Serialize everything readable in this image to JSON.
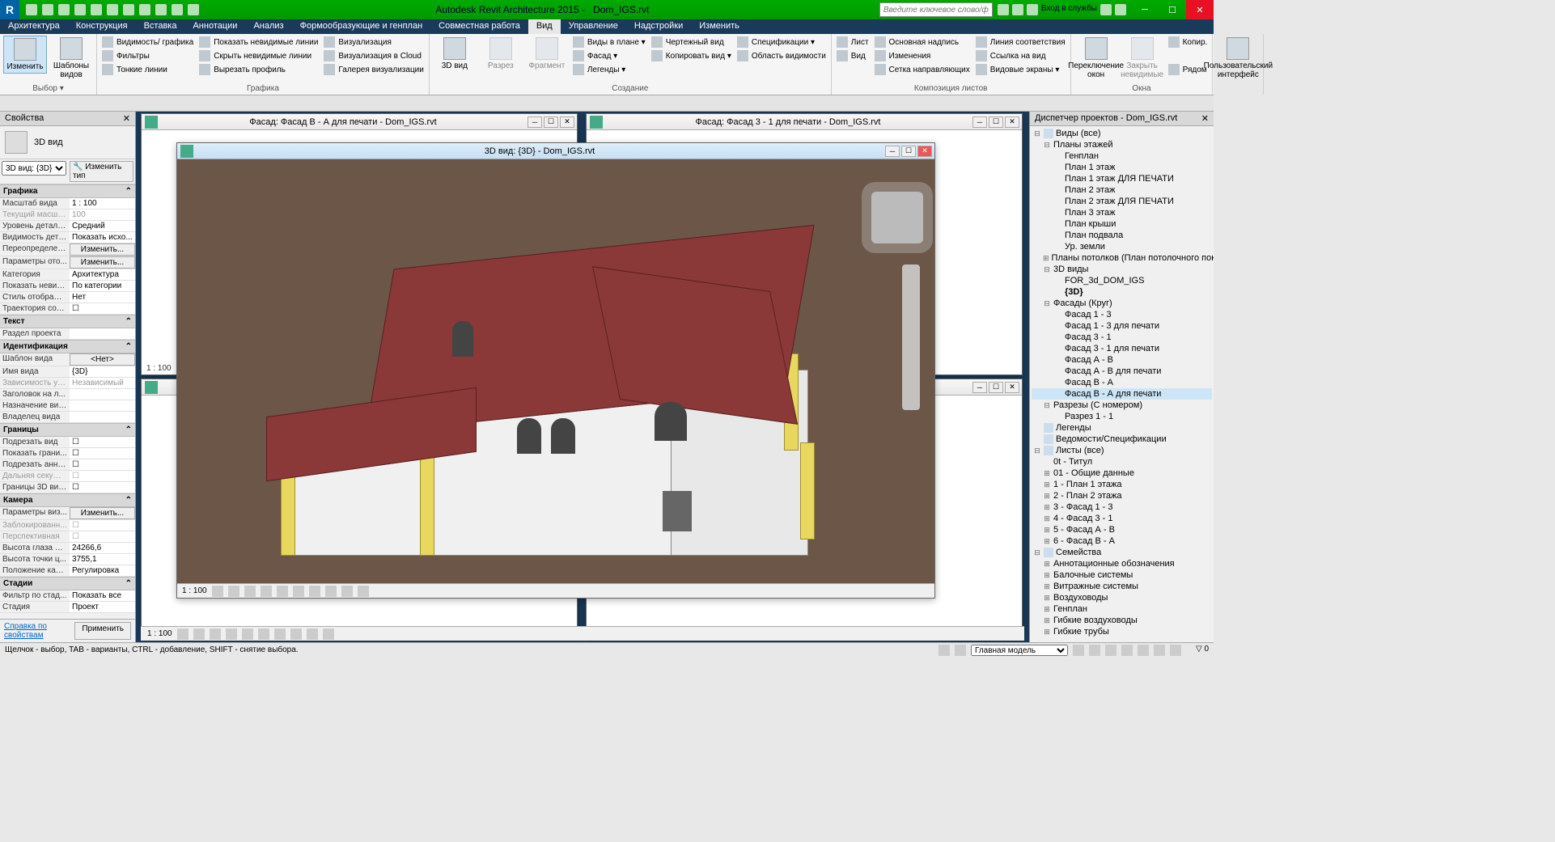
{
  "titlebar": {
    "app": "Autodesk Revit Architecture 2015 -",
    "file": "Dom_IGS.rvt",
    "search_placeholder": "Введите ключевое слово/фразу",
    "login": "Вход в службы"
  },
  "menutabs": [
    "Архитектура",
    "Конструкция",
    "Вставка",
    "Аннотации",
    "Анализ",
    "Формообразующие и генплан",
    "Совместная работа",
    "Вид",
    "Управление",
    "Надстройки",
    "Изменить"
  ],
  "menutab_active": 7,
  "ribbon": {
    "groups": [
      {
        "label": "Выбор ▾",
        "big": [
          {
            "t": "Изменить",
            "sel": true
          },
          {
            "t": "Шаблоны видов"
          }
        ]
      },
      {
        "label": "Графика",
        "cols": [
          [
            "Видимость/ графика",
            "Фильтры",
            "Тонкие линии"
          ],
          [
            "Показать невидимые линии",
            "Скрыть невидимые линии",
            "Вырезать профиль"
          ],
          [
            "Визуализация",
            "Визуализация в Cloud",
            "Галерея визуализации"
          ]
        ]
      },
      {
        "label": "Создание",
        "big": [
          {
            "t": "3D вид"
          },
          {
            "t": "Разрез",
            "dis": true
          },
          {
            "t": "Фрагмент",
            "dis": true
          }
        ],
        "cols": [
          [
            "Виды в плане ▾",
            "Фасад ▾",
            "Легенды ▾"
          ],
          [
            "Чертежный вид",
            "Копировать вид ▾",
            ""
          ],
          [
            "Спецификации ▾",
            "Область видимости",
            ""
          ]
        ]
      },
      {
        "label": "Композиция листов",
        "cols": [
          [
            "Лист",
            "Вид",
            ""
          ],
          [
            "Основная надпись",
            "Изменения",
            "Сетка направляющих"
          ],
          [
            "Линия соответствия",
            "Ссылка на вид",
            "Видовые экраны ▾"
          ]
        ]
      },
      {
        "label": "Окна",
        "big": [
          {
            "t": "Переключение окон"
          },
          {
            "t": "Закрыть невидимые",
            "dis": true
          }
        ],
        "cols": [
          [
            "Копир.",
            "",
            "Рядом"
          ]
        ]
      },
      {
        "label": "",
        "big": [
          {
            "t": "Пользовательский интерфейс"
          }
        ]
      }
    ]
  },
  "properties": {
    "title": "Свойства",
    "viewtype": "3D вид",
    "selector": "3D вид: {3D}",
    "edit_type": "Изменить тип",
    "groups": [
      {
        "name": "Графика",
        "rows": [
          {
            "k": "Масштаб вида",
            "v": "1 : 100"
          },
          {
            "k": "Текущий масшт...",
            "v": "100",
            "dis": true
          },
          {
            "k": "Уровень детали...",
            "v": "Средний"
          },
          {
            "k": "Видимость дета...",
            "v": "Показать исхо..."
          },
          {
            "k": "Переопределен...",
            "v": "Изменить...",
            "btn": true
          },
          {
            "k": "Параметры ото...",
            "v": "Изменить...",
            "btn": true
          },
          {
            "k": "Категория",
            "v": "Архитектура"
          },
          {
            "k": "Показать невид...",
            "v": "По категории"
          },
          {
            "k": "Стиль отображе...",
            "v": "Нет"
          },
          {
            "k": "Траектория сол...",
            "v": "",
            "chk": true
          }
        ]
      },
      {
        "name": "Текст",
        "rows": [
          {
            "k": "Раздел проекта",
            "v": ""
          }
        ]
      },
      {
        "name": "Идентификация",
        "rows": [
          {
            "k": "Шаблон вида",
            "v": "<Нет>",
            "btn": true
          },
          {
            "k": "Имя вида",
            "v": "{3D}"
          },
          {
            "k": "Зависимость ур...",
            "v": "Независимый",
            "dis": true
          },
          {
            "k": "Заголовок на л...",
            "v": ""
          },
          {
            "k": "Назначение вида",
            "v": ""
          },
          {
            "k": "Владелец вида",
            "v": ""
          }
        ]
      },
      {
        "name": "Границы",
        "rows": [
          {
            "k": "Подрезать вид",
            "v": "",
            "chk": true
          },
          {
            "k": "Показать грани...",
            "v": "",
            "chk": true
          },
          {
            "k": "Подрезать анно...",
            "v": "",
            "chk": true
          },
          {
            "k": "Дальняя секуща...",
            "v": "",
            "chk": true,
            "dis": true
          },
          {
            "k": "Границы 3D вида",
            "v": "",
            "chk": true
          }
        ]
      },
      {
        "name": "Камера",
        "rows": [
          {
            "k": "Параметры виз...",
            "v": "Изменить...",
            "btn": true
          },
          {
            "k": "Заблокированн...",
            "v": "",
            "chk": true,
            "dis": true
          },
          {
            "k": "Перспективная",
            "v": "",
            "chk": true,
            "dis": true
          },
          {
            "k": "Высота глаза на...",
            "v": "24266,6"
          },
          {
            "k": "Высота точки ц...",
            "v": "3755,1"
          },
          {
            "k": "Положение кам...",
            "v": "Регулировка"
          }
        ]
      },
      {
        "name": "Стадии",
        "rows": [
          {
            "k": "Фильтр по стад...",
            "v": "Показать все"
          },
          {
            "k": "Стадия",
            "v": "Проект"
          }
        ]
      }
    ],
    "help": "Справка по свойствам",
    "apply": "Применить"
  },
  "windows": {
    "w1": {
      "title": "Фасад: Фасад В - А для печати - Dom_IGS.rvt",
      "scale": "1 : 100"
    },
    "w2": {
      "title": "Фасад: Фасад 3 - 1 для печати - Dom_IGS.rvt"
    },
    "w3": {
      "title": "3D вид: {3D} - Dom_IGS.rvt",
      "scale": "1 : 100"
    }
  },
  "browser": {
    "title": "Диспетчер проектов - Dom_IGS.rvt",
    "nodes": [
      {
        "l": 0,
        "t": "Виды (все)",
        "exp": "-",
        "icon": true
      },
      {
        "l": 1,
        "t": "Планы этажей",
        "exp": "-"
      },
      {
        "l": 2,
        "t": "Генплан"
      },
      {
        "l": 2,
        "t": "План 1 этаж"
      },
      {
        "l": 2,
        "t": "План 1 этаж ДЛЯ ПЕЧАТИ"
      },
      {
        "l": 2,
        "t": "План 2 этаж"
      },
      {
        "l": 2,
        "t": "План 2 этаж ДЛЯ ПЕЧАТИ"
      },
      {
        "l": 2,
        "t": "План 3 этаж"
      },
      {
        "l": 2,
        "t": "План крыши"
      },
      {
        "l": 2,
        "t": "План подвала"
      },
      {
        "l": 2,
        "t": "Ур. земли"
      },
      {
        "l": 1,
        "t": "Планы потолков (План потолочного покр",
        "exp": "+"
      },
      {
        "l": 1,
        "t": "3D виды",
        "exp": "-"
      },
      {
        "l": 2,
        "t": "FOR_3d_DOM_IGS"
      },
      {
        "l": 2,
        "t": "{3D}",
        "bold": true
      },
      {
        "l": 1,
        "t": "Фасады (Круг)",
        "exp": "-"
      },
      {
        "l": 2,
        "t": "Фасад 1 - 3"
      },
      {
        "l": 2,
        "t": "Фасад 1 - 3 для печати"
      },
      {
        "l": 2,
        "t": "Фасад 3 - 1"
      },
      {
        "l": 2,
        "t": "Фасад 3 - 1 для печати"
      },
      {
        "l": 2,
        "t": "Фасад А - В"
      },
      {
        "l": 2,
        "t": "Фасад А - В для печати"
      },
      {
        "l": 2,
        "t": "Фасад В - А"
      },
      {
        "l": 2,
        "t": "Фасад В - А для печати",
        "sel": true
      },
      {
        "l": 1,
        "t": "Разрезы (С номером)",
        "exp": "-"
      },
      {
        "l": 2,
        "t": "Разрез 1 - 1"
      },
      {
        "l": 0,
        "t": "Легенды",
        "icon": true
      },
      {
        "l": 0,
        "t": "Ведомости/Спецификации",
        "icon": true
      },
      {
        "l": 0,
        "t": "Листы (все)",
        "exp": "-",
        "icon": true
      },
      {
        "l": 1,
        "t": "0t - Титул"
      },
      {
        "l": 1,
        "t": "01 - Общие данные",
        "exp": "+"
      },
      {
        "l": 1,
        "t": "1 - План 1 этажа",
        "exp": "+"
      },
      {
        "l": 1,
        "t": "2 - План 2 этажа",
        "exp": "+"
      },
      {
        "l": 1,
        "t": "3 - Фасад 1 - 3",
        "exp": "+"
      },
      {
        "l": 1,
        "t": "4 - Фасад 3 - 1",
        "exp": "+"
      },
      {
        "l": 1,
        "t": "5 - Фасад А - В",
        "exp": "+"
      },
      {
        "l": 1,
        "t": "6 - Фасад В - А",
        "exp": "+"
      },
      {
        "l": 0,
        "t": "Семейства",
        "exp": "-",
        "icon": true
      },
      {
        "l": 1,
        "t": "Аннотационные обозначения",
        "exp": "+"
      },
      {
        "l": 1,
        "t": "Балочные системы",
        "exp": "+"
      },
      {
        "l": 1,
        "t": "Витражные системы",
        "exp": "+"
      },
      {
        "l": 1,
        "t": "Воздуховоды",
        "exp": "+"
      },
      {
        "l": 1,
        "t": "Генплан",
        "exp": "+"
      },
      {
        "l": 1,
        "t": "Гибкие воздуховоды",
        "exp": "+"
      },
      {
        "l": 1,
        "t": "Гибкие трубы",
        "exp": "+"
      }
    ]
  },
  "statusbar": {
    "hint": "Щелчок - выбор, TAB - варианты, CTRL - добавление, SHIFT - снятие выбора.",
    "model": "Главная модель"
  },
  "viewbar_scale": "1 : 100"
}
